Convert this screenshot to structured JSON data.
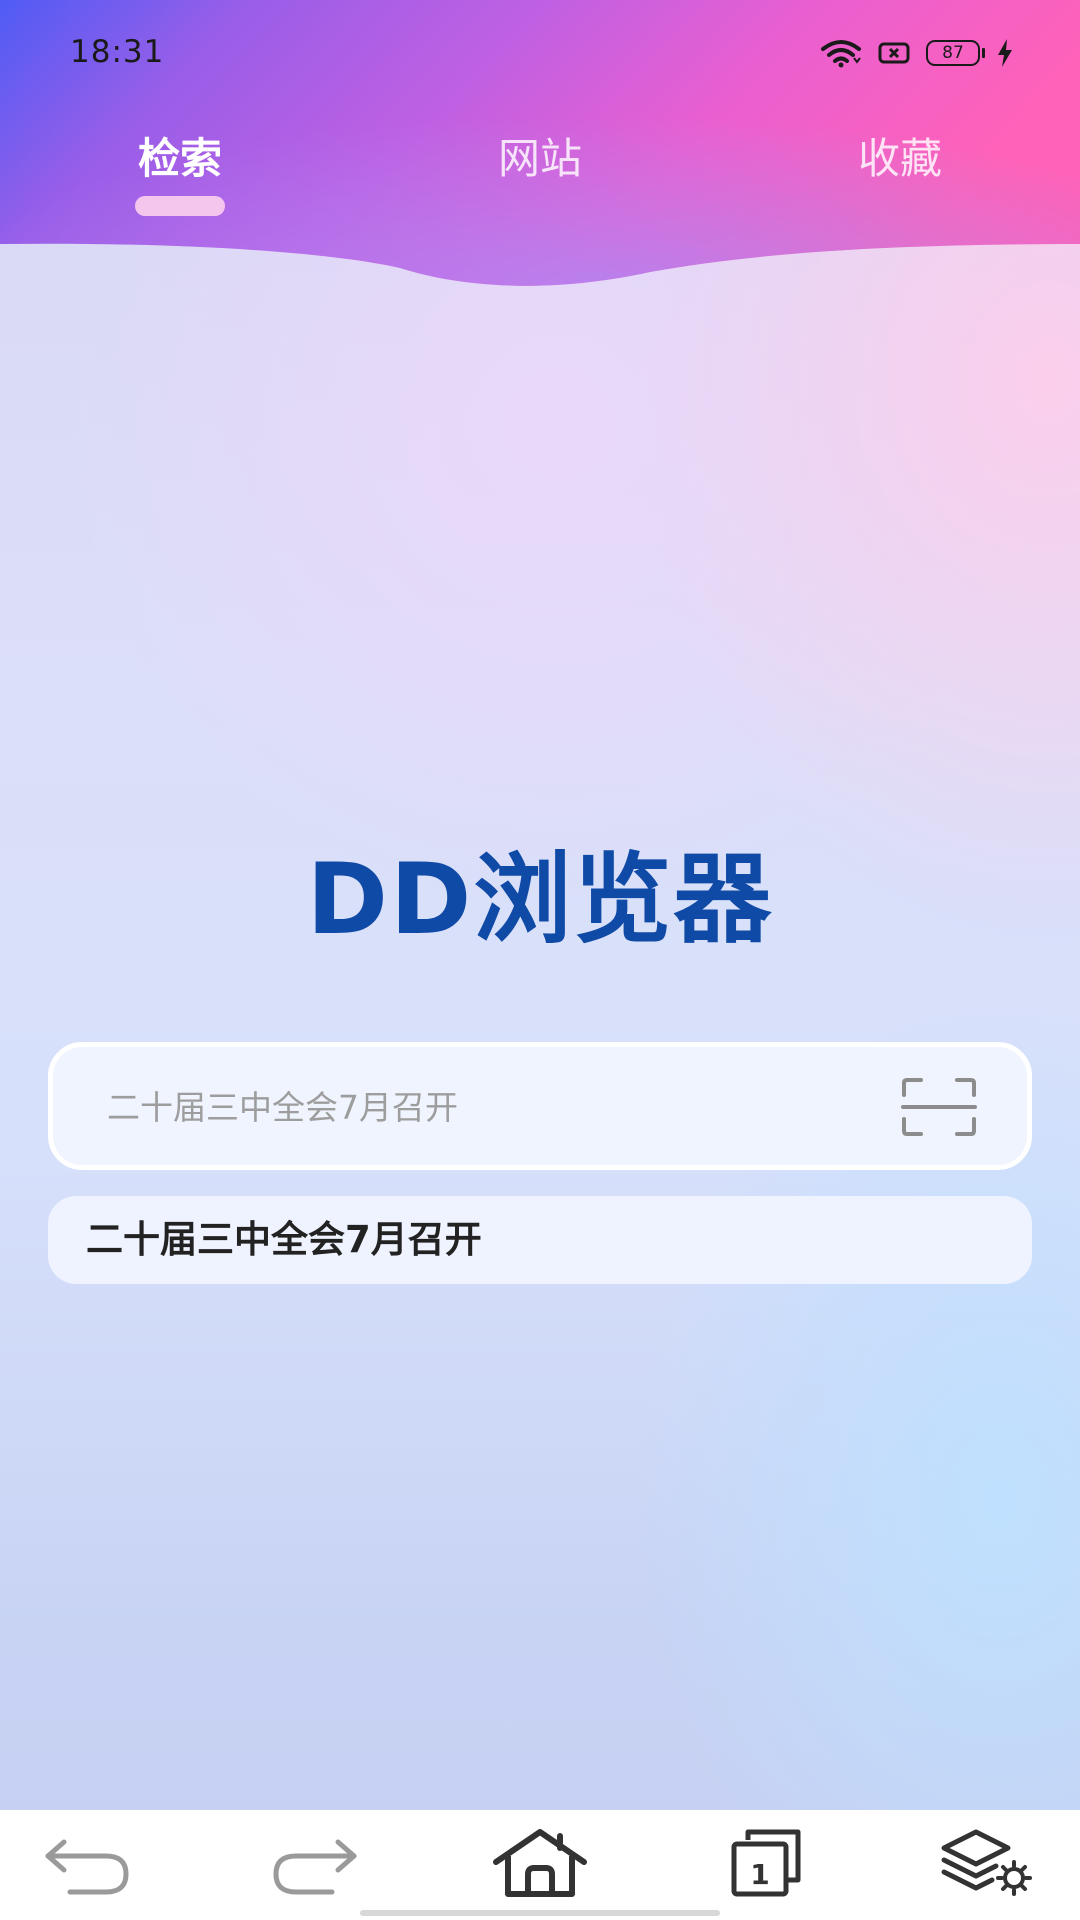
{
  "status_bar": {
    "time": "18:31",
    "battery_level": "87",
    "icons": [
      "wifi-icon",
      "sim-off-icon",
      "battery-icon",
      "charging-icon"
    ]
  },
  "tabs": [
    {
      "label": "检索",
      "active": true
    },
    {
      "label": "网站",
      "active": false
    },
    {
      "label": "收藏",
      "active": false
    }
  ],
  "app_title": "DD浏览器",
  "search": {
    "placeholder": "二十届三中全会7月召开",
    "value": ""
  },
  "suggestions": [
    "二十届三中全会7月召开"
  ],
  "bottom_nav": {
    "items": [
      "back-icon",
      "forward-icon",
      "home-icon",
      "tabs-icon",
      "layers-settings-icon"
    ],
    "tab_count": "1"
  },
  "colors": {
    "title": "#0f4aa6",
    "header_gradient": [
      "#5b5cf0",
      "#b559e6",
      "#f060c8",
      "#ff5fb0"
    ],
    "tab_indicator": "#f4c6ee"
  }
}
